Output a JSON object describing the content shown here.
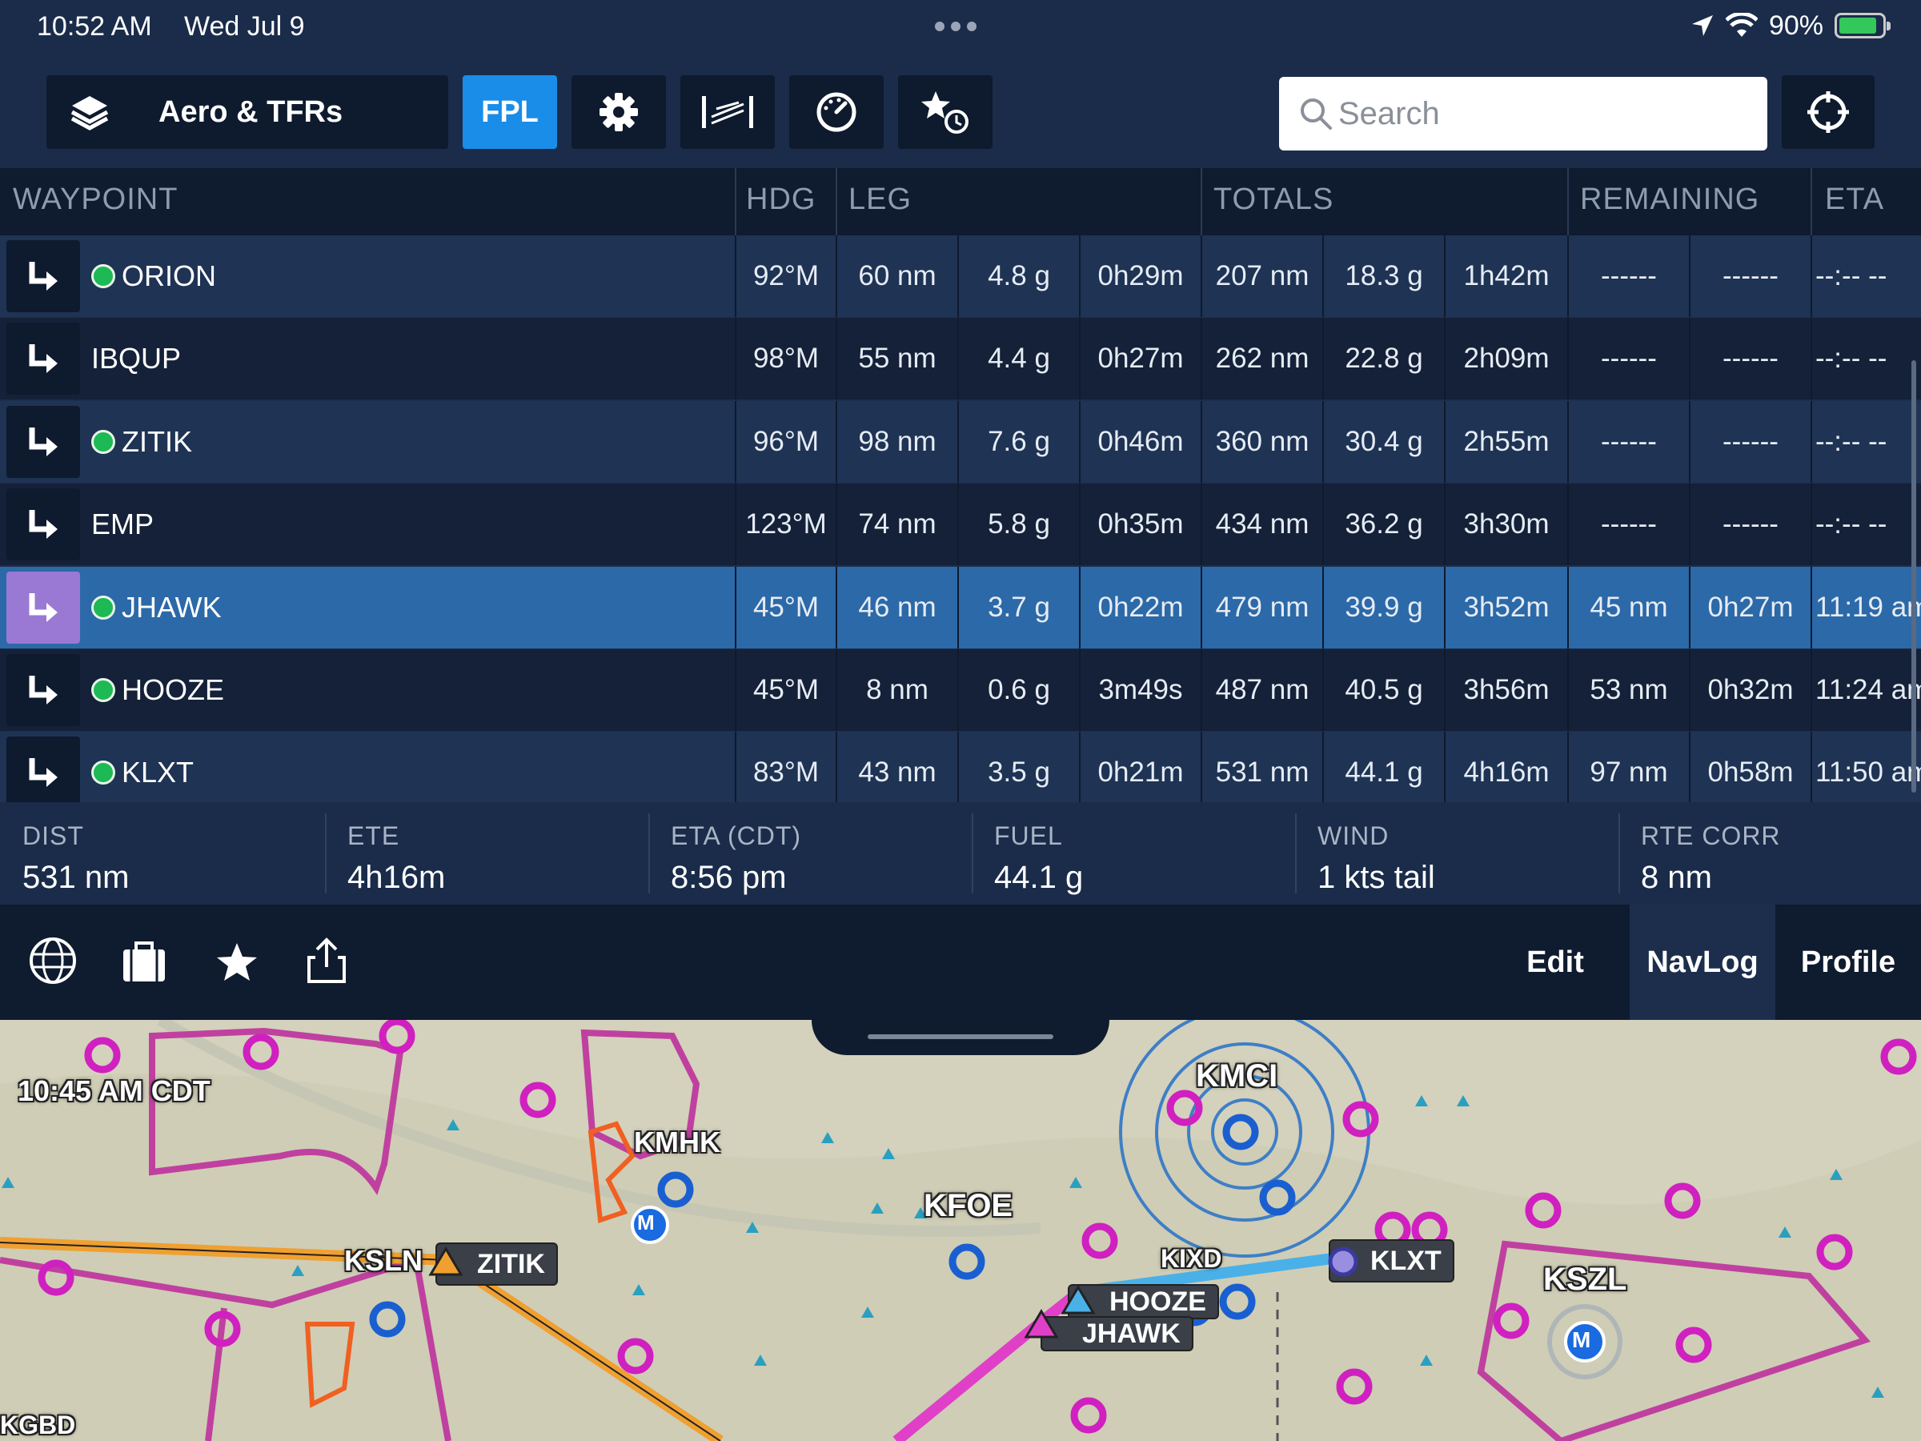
{
  "status_bar": {
    "time": "10:52 AM",
    "date": "Wed Jul 9",
    "battery": "90%"
  },
  "toolbar": {
    "layer_label": "Aero & TFRs",
    "fpl_label": "FPL",
    "search_placeholder": "Search"
  },
  "table": {
    "headers": {
      "waypoint": "WAYPOINT",
      "hdg": "HDG",
      "leg": "LEG",
      "totals": "TOTALS",
      "remaining": "REMAINING",
      "eta": "ETA"
    },
    "rows": [
      {
        "wp": "ORION",
        "dot": true,
        "hdg": "92°M",
        "leg_dist": "60 nm",
        "leg_fuel": "4.8 g",
        "leg_time": "0h29m",
        "tot_dist": "207 nm",
        "tot_fuel": "18.3 g",
        "tot_time": "1h42m",
        "rem_dist": "------",
        "rem_time": "------",
        "eta": "--:-- --"
      },
      {
        "wp": "IBQUP",
        "dot": false,
        "hdg": "98°M",
        "leg_dist": "55 nm",
        "leg_fuel": "4.4 g",
        "leg_time": "0h27m",
        "tot_dist": "262 nm",
        "tot_fuel": "22.8 g",
        "tot_time": "2h09m",
        "rem_dist": "------",
        "rem_time": "------",
        "eta": "--:-- --"
      },
      {
        "wp": "ZITIK",
        "dot": true,
        "hdg": "96°M",
        "leg_dist": "98 nm",
        "leg_fuel": "7.6 g",
        "leg_time": "0h46m",
        "tot_dist": "360 nm",
        "tot_fuel": "30.4 g",
        "tot_time": "2h55m",
        "rem_dist": "------",
        "rem_time": "------",
        "eta": "--:-- --"
      },
      {
        "wp": "EMP",
        "dot": false,
        "hdg": "123°M",
        "leg_dist": "74 nm",
        "leg_fuel": "5.8 g",
        "leg_time": "0h35m",
        "tot_dist": "434 nm",
        "tot_fuel": "36.2 g",
        "tot_time": "3h30m",
        "rem_dist": "------",
        "rem_time": "------",
        "eta": "--:-- --"
      },
      {
        "wp": "JHAWK",
        "dot": true,
        "hdg": "45°M",
        "leg_dist": "46 nm",
        "leg_fuel": "3.7 g",
        "leg_time": "0h22m",
        "tot_dist": "479 nm",
        "tot_fuel": "39.9 g",
        "tot_time": "3h52m",
        "rem_dist": "45 nm",
        "rem_time": "0h27m",
        "eta": "11:19 am"
      },
      {
        "wp": "HOOZE",
        "dot": true,
        "hdg": "45°M",
        "leg_dist": "8 nm",
        "leg_fuel": "0.6 g",
        "leg_time": "3m49s",
        "tot_dist": "487 nm",
        "tot_fuel": "40.5 g",
        "tot_time": "3h56m",
        "rem_dist": "53 nm",
        "rem_time": "0h32m",
        "eta": "11:24 am"
      },
      {
        "wp": "KLXT",
        "dot": true,
        "hdg": "83°M",
        "leg_dist": "43 nm",
        "leg_fuel": "3.5 g",
        "leg_time": "0h21m",
        "tot_dist": "531 nm",
        "tot_fuel": "44.1 g",
        "tot_time": "4h16m",
        "rem_dist": "97 nm",
        "rem_time": "0h58m",
        "eta": "11:50 am"
      }
    ]
  },
  "totals_bar": [
    {
      "label": "DIST",
      "value": "531 nm"
    },
    {
      "label": "ETE",
      "value": "4h16m"
    },
    {
      "label": "ETA (CDT)",
      "value": "8:56 pm"
    },
    {
      "label": "FUEL",
      "value": "44.1 g"
    },
    {
      "label": "WIND",
      "value": "1 kts tail"
    },
    {
      "label": "RTE CORR",
      "value": "8 nm"
    }
  ],
  "bottom_tabs": {
    "edit": "Edit",
    "navlog": "NavLog",
    "profile": "Profile"
  },
  "map": {
    "time_label": "10:45 AM CDT",
    "airports": [
      "KMCI",
      "KMHK",
      "KFOE",
      "KSZL",
      "KSLN",
      "KIXD",
      "KGBD"
    ],
    "waypoint_tags": [
      "ZITIK",
      "HOOZE",
      "JHAWK",
      "KLXT"
    ],
    "m_badge": "M"
  },
  "colors": {
    "fpl_blue": "#1a8de8",
    "active_row": "#2c69a8",
    "route_magenta": "#e040c8",
    "route_orange": "#f0a030",
    "route_cyan": "#4ab0e8",
    "airspace_magenta": "#c040a0"
  }
}
